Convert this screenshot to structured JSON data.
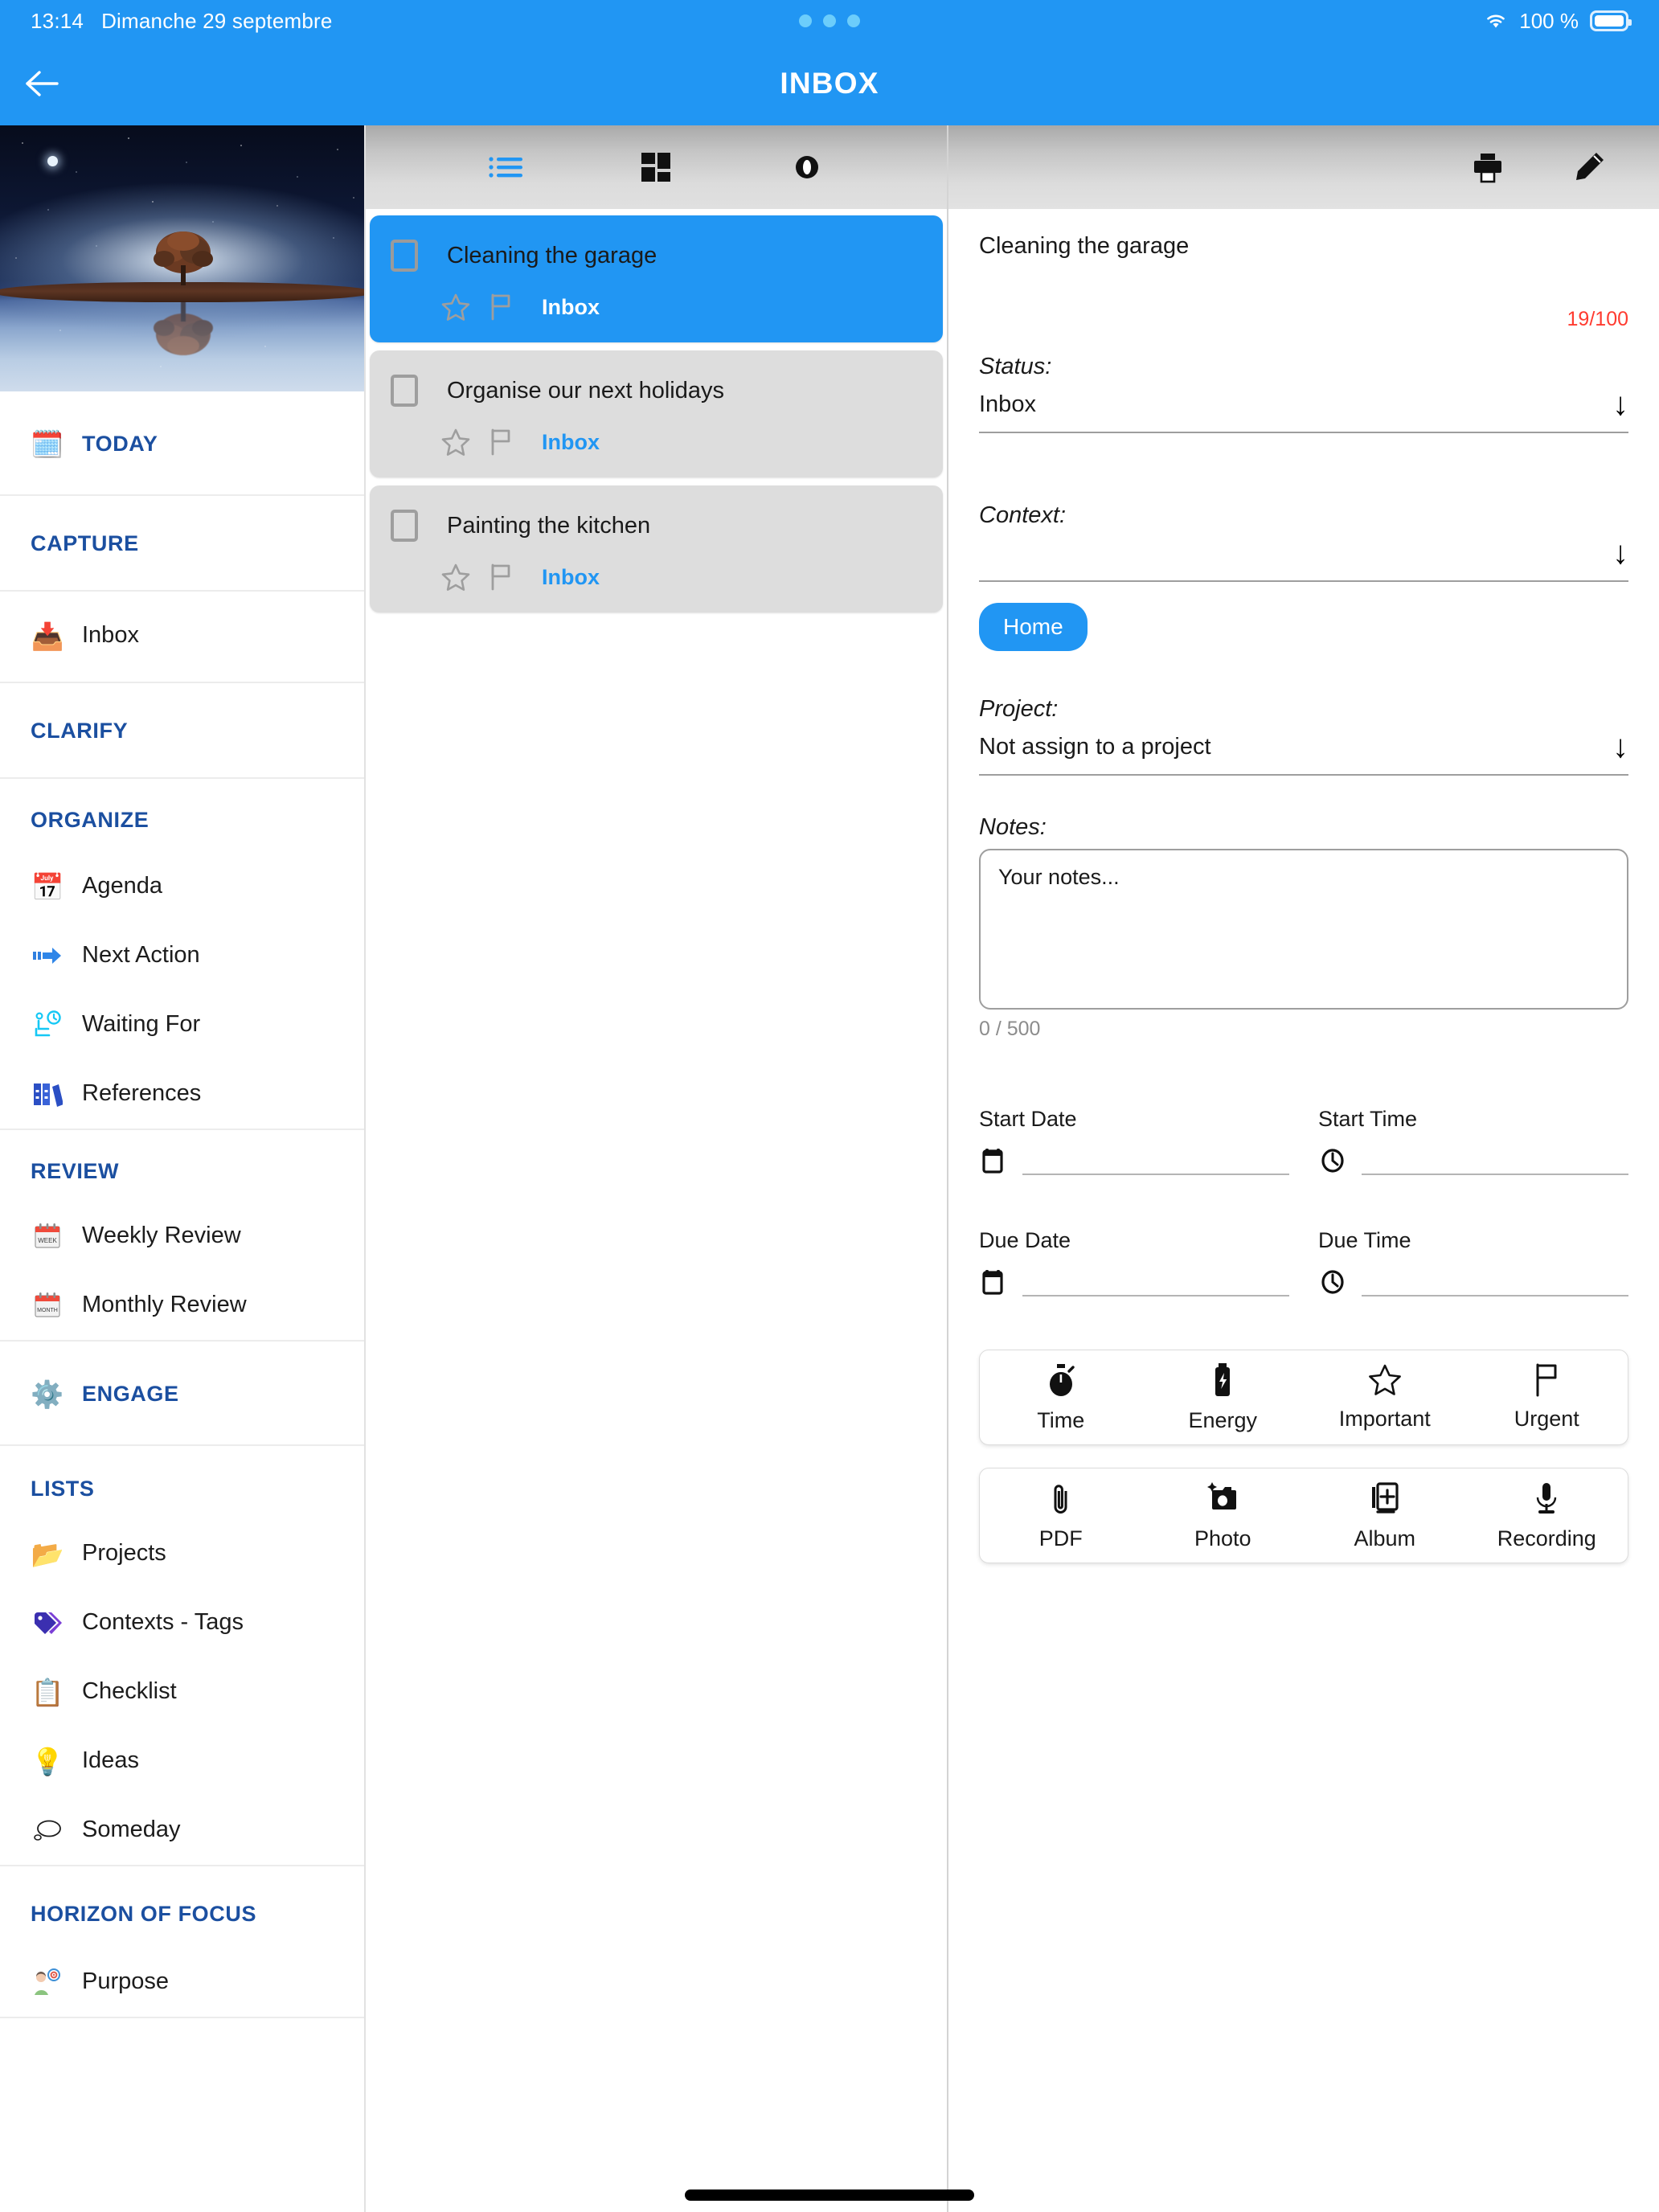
{
  "status_bar": {
    "time": "13:14",
    "date": "Dimanche 29 septembre",
    "battery_percent": "100 %",
    "wifi_icon": "wifi-icon",
    "battery_icon": "battery-icon",
    "dots_indicator": "three-dots-indicator"
  },
  "app_bar": {
    "back_icon": "arrow-left-icon",
    "title": "INBOX"
  },
  "sidebar": {
    "hero_image": "night-tree-reflection-photo",
    "sections": [
      {
        "header": "TODAY",
        "header_icon": "calendar-check-icon",
        "header_is_item": true,
        "items": []
      },
      {
        "header": "CAPTURE",
        "header_icon": "",
        "items": []
      },
      {
        "header": "",
        "items": [
          {
            "label": "Inbox",
            "icon": "inbox-tray-icon"
          }
        ]
      },
      {
        "header": "CLARIFY",
        "header_icon": "",
        "items": []
      },
      {
        "header": "ORGANIZE",
        "header_icon": "",
        "items": [
          {
            "label": "Agenda",
            "icon": "calendar-icon"
          },
          {
            "label": "Next Action",
            "icon": "arrow-right-icon"
          },
          {
            "label": "Waiting For",
            "icon": "person-waiting-clock-icon"
          },
          {
            "label": "References",
            "icon": "binders-icon"
          }
        ]
      },
      {
        "header": "REVIEW",
        "header_icon": "",
        "items": [
          {
            "label": "Weekly Review",
            "icon": "calendar-week-icon"
          },
          {
            "label": "Monthly Review",
            "icon": "calendar-month-icon"
          }
        ]
      },
      {
        "header": "ENGAGE",
        "header_icon": "gears-icon",
        "header_is_item": true,
        "items": []
      },
      {
        "header": "LISTS",
        "header_icon": "",
        "items": [
          {
            "label": "Projects",
            "icon": "folder-icon"
          },
          {
            "label": "Contexts - Tags",
            "icon": "tags-icon"
          },
          {
            "label": "Checklist",
            "icon": "checklist-icon"
          },
          {
            "label": "Ideas",
            "icon": "lightbulb-icon"
          },
          {
            "label": "Someday",
            "icon": "thought-bubble-icon"
          }
        ]
      },
      {
        "header": "HORIZON OF FOCUS",
        "header_icon": "",
        "items": [
          {
            "label": "Purpose",
            "icon": "person-target-icon"
          }
        ]
      }
    ]
  },
  "list_panel": {
    "toolbar": [
      {
        "name": "list-view-button",
        "icon": "list-view-icon"
      },
      {
        "name": "grid-view-button",
        "icon": "grid-view-icon"
      },
      {
        "name": "preview-button",
        "icon": "eye-icon"
      }
    ],
    "tasks": [
      {
        "title": "Cleaning the garage",
        "badge": "Inbox",
        "selected": true,
        "checked": false,
        "star_icon": "star-icon",
        "flag_icon": "flag-icon"
      },
      {
        "title": "Organise our next holidays",
        "badge": "Inbox",
        "selected": false,
        "checked": false,
        "star_icon": "star-icon",
        "flag_icon": "flag-icon"
      },
      {
        "title": "Painting the kitchen",
        "badge": "Inbox",
        "selected": false,
        "checked": false,
        "star_icon": "star-icon",
        "flag_icon": "flag-icon"
      }
    ]
  },
  "detail_panel": {
    "toolbar": [
      {
        "name": "print-button",
        "icon": "printer-icon"
      },
      {
        "name": "edit-button",
        "icon": "pencil-icon"
      }
    ],
    "task_title": "Cleaning the garage",
    "char_count": "19/100",
    "status_label": "Status:",
    "status_value": "Inbox",
    "context_label": "Context:",
    "context_value": "",
    "context_chip": "Home",
    "project_label": "Project:",
    "project_value": "Not assign to a project",
    "notes_label": "Notes:",
    "notes_placeholder": "Your notes...",
    "notes_count": "0 / 500",
    "datetime": [
      {
        "label": "Start Date",
        "value": "",
        "icon": "calendar-icon"
      },
      {
        "label": "Start Time",
        "value": "",
        "icon": "clock-icon"
      },
      {
        "label": "Due Date",
        "value": "",
        "icon": "calendar-icon"
      },
      {
        "label": "Due Time",
        "value": "",
        "icon": "clock-icon"
      }
    ],
    "attribute_buttons": [
      {
        "label": "Time",
        "icon": "stopwatch-icon"
      },
      {
        "label": "Energy",
        "icon": "battery-bolt-icon"
      },
      {
        "label": "Important",
        "icon": "star-icon"
      },
      {
        "label": "Urgent",
        "icon": "flag-icon"
      }
    ],
    "attachment_buttons": [
      {
        "label": "PDF",
        "icon": "paperclip-icon"
      },
      {
        "label": "Photo",
        "icon": "camera-icon"
      },
      {
        "label": "Album",
        "icon": "album-plus-icon"
      },
      {
        "label": "Recording",
        "icon": "microphone-icon"
      }
    ]
  },
  "colors": {
    "accent": "#2196f3",
    "section_header": "#1b4fa0",
    "char_count": "#ff3b30",
    "card_bg": "#dddddd"
  }
}
